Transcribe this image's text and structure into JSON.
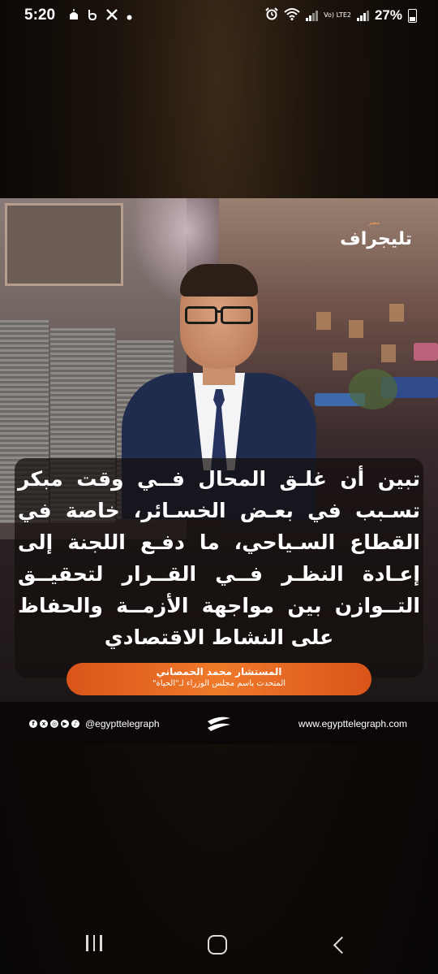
{
  "status_bar": {
    "time": "5:20",
    "left_icons": [
      "mosque-icon",
      "notification-b-icon",
      "x-icon",
      "dot-icon"
    ],
    "right_icons": [
      "alarm-icon",
      "wifi-icon",
      "signal-icon",
      "volte-icon",
      "signal-icon"
    ],
    "volte_label": "Vo) LTE2",
    "battery": "27%"
  },
  "poster": {
    "logo_text": "تليجراف",
    "logo_sub": "مصر",
    "quote": "تبين أن غلـق المحال فــي وقت مبكر تسـبب في بعـض الخسـائر، خاصة في القطاع السـياحي، ما دفـع اللجنة إلى إعـادة النظـر فــي القــرار لتحقيــق التــوازن بين مواجهة الأزمــة والحفاظ على النشاط الاقتصادي",
    "speaker_name": "المستشار محمد الحمصاني",
    "speaker_title": "المتحدث باسم مجلس الوزراء لـ\"الحياة\"",
    "social_icons": [
      "facebook-icon",
      "x-icon",
      "instagram-icon",
      "youtube-icon",
      "tiktok-icon"
    ],
    "handle": "@egypttelegraph",
    "website": "www.egypttelegraph.com",
    "accent_color": "#f07a2a",
    "suit_color": "#1f2c4d"
  },
  "nav_bar": {
    "buttons": [
      "recents-icon",
      "home-icon",
      "back-icon"
    ]
  }
}
